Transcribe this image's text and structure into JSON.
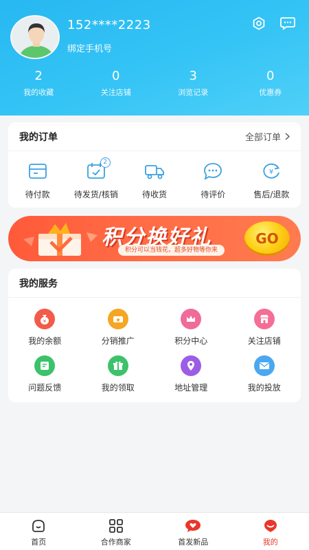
{
  "header": {
    "phone": "152****2223",
    "bind_phone": "绑定手机号",
    "stats": [
      {
        "value": "2",
        "label": "我的收藏"
      },
      {
        "value": "0",
        "label": "关注店铺"
      },
      {
        "value": "3",
        "label": "浏览记录"
      },
      {
        "value": "0",
        "label": "优惠券"
      }
    ]
  },
  "orders": {
    "title": "我的订单",
    "all_label": "全部订单",
    "items": [
      {
        "label": "待付款",
        "icon": "wallet-icon"
      },
      {
        "label": "待发货/核销",
        "icon": "calendar-check-icon",
        "badge": "2"
      },
      {
        "label": "待收货",
        "icon": "truck-icon"
      },
      {
        "label": "待评价",
        "icon": "chat-bubble-icon"
      },
      {
        "label": "售后/退款",
        "icon": "refund-icon"
      }
    ]
  },
  "banner": {
    "title": "积分换好礼",
    "subtitle": "积分可以当钱花，超多好物等你来",
    "go": "GO"
  },
  "services": {
    "title": "我的服务",
    "items": [
      {
        "label": "我的余额",
        "icon": "money-bag-icon",
        "color": "#f25a4a"
      },
      {
        "label": "分销推广",
        "icon": "ticket-icon",
        "color": "#f5a623"
      },
      {
        "label": "积分中心",
        "icon": "crown-icon",
        "color": "#f06b9a"
      },
      {
        "label": "关注店铺",
        "icon": "shop-icon",
        "color": "#f56e95"
      },
      {
        "label": "问题反馈",
        "icon": "feedback-icon",
        "color": "#3cc26a"
      },
      {
        "label": "我的领取",
        "icon": "gift-icon",
        "color": "#3cc26a"
      },
      {
        "label": "地址管理",
        "icon": "location-icon",
        "color": "#9b5de5"
      },
      {
        "label": "我的投放",
        "icon": "mail-icon",
        "color": "#4aa8f0"
      }
    ]
  },
  "tabbar": {
    "items": [
      {
        "label": "首页",
        "icon": "home-icon"
      },
      {
        "label": "合作商家",
        "icon": "grid-icon"
      },
      {
        "label": "首发新品",
        "icon": "heart-bubble-icon"
      },
      {
        "label": "我的",
        "icon": "profile-icon",
        "active": true
      }
    ]
  },
  "colors": {
    "header": "#35c4f5",
    "accent": "#e8382b",
    "order_icon": "#3aa0e0"
  }
}
